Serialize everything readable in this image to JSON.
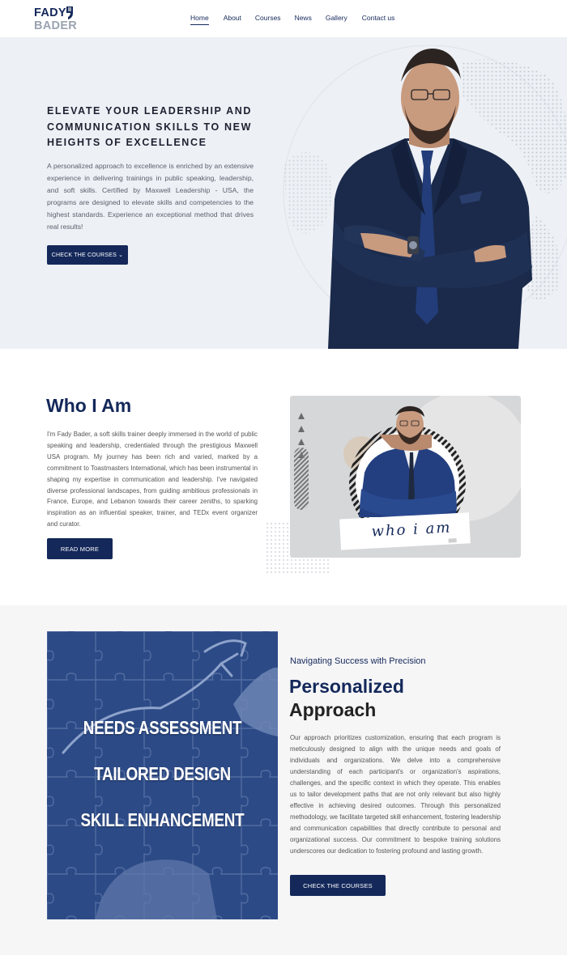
{
  "brand": {
    "line1": "FADY",
    "line2": "BADER"
  },
  "nav": [
    {
      "label": "Home",
      "active": true
    },
    {
      "label": "About"
    },
    {
      "label": "Courses"
    },
    {
      "label": "News"
    },
    {
      "label": "Gallery"
    },
    {
      "label": "Contact us"
    }
  ],
  "hero": {
    "title": "ELEVATE YOUR LEADERSHIP AND COMMUNICATION SKILLS TO NEW HEIGHTS OF EXCELLENCE",
    "text": "A personalized approach to excellence is enriched by an extensive experience in delivering trainings in public speaking, leadership, and soft skills. Certified by Maxwell Leadership - USA, the programs are designed to elevate skills and competencies to the highest standards. Experience an exceptional method that drives real results!",
    "button": "CHECK THE COURSES ⌄"
  },
  "who": {
    "title": "Who I Am",
    "text": "I'm Fady Bader, a soft skills trainer deeply immersed in the world of public speaking and leadership, credentialed through the prestigious Maxwell USA program. My journey has been rich and varied, marked by a commitment to Toastmasters International, which has been instrumental in shaping my expertise in communication and leadership. I've navigated diverse professional landscapes, from guiding ambitious professionals in France, Europe, and Lebanon towards their career zeniths, to sparking inspiration as an influential speaker, trainer, and TEDx event organizer and curator.",
    "button": "READ MORE",
    "card_caption": "who i am"
  },
  "approach": {
    "subtitle": "Navigating Success with Precision",
    "title_line1": "Personalized",
    "title_line2": "Approach",
    "text": "Our approach prioritizes customization, ensuring that each program is meticulously designed to align with the unique needs and goals of individuals and organizations. We delve into a comprehensive understanding of each participant's or organization's aspirations, challenges, and the specific context in which they operate. This enables us to tailor development paths that are not only relevant but also highly effective in achieving desired outcomes. Through this personalized methodology, we facilitate targeted skill enhancement, fostering leadership and communication capabilities that directly contribute to personal and organizational success. Our commitment to bespoke training solutions underscores our dedication to fostering profound and lasting growth.",
    "button": "CHECK THE COURSES",
    "image_words": [
      "NEEDS ASSESSMENT",
      "TAILORED DESIGN",
      "SKILL ENHANCEMENT"
    ]
  },
  "colors": {
    "navy": "#14285a",
    "hero_bg": "#edf0f5",
    "band_bg": "#f6f6f7",
    "puzzle_blue": "#2c4a86"
  }
}
